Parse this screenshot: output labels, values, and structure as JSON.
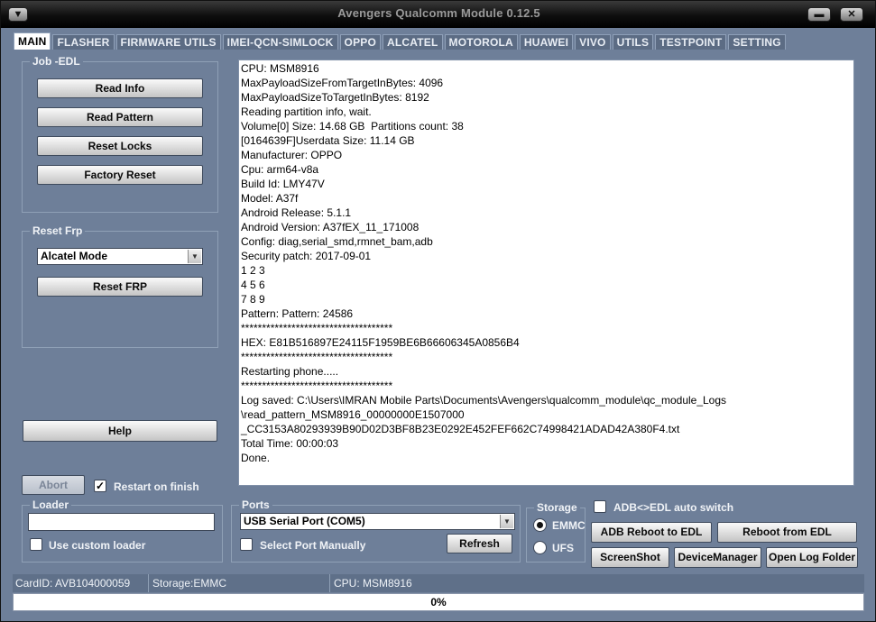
{
  "window": {
    "title": "Avengers Qualcomm Module 0.12.5"
  },
  "tabs": [
    "MAIN",
    "FLASHER",
    "FIRMWARE UTILS",
    "IMEI-QCN-SIMLOCK",
    "OPPO",
    "ALCATEL",
    "MOTOROLA",
    "HUAWEI",
    "VIVO",
    "UTILS",
    "TESTPOINT",
    "SETTING"
  ],
  "active_tab": "MAIN",
  "job_edl": {
    "title": "Job -EDL",
    "read_info": "Read Info",
    "read_pattern": "Read Pattern",
    "reset_locks": "Reset Locks",
    "factory_reset": "Factory Reset"
  },
  "reset_frp": {
    "title": "Reset Frp",
    "mode_value": "Alcatel Mode",
    "reset_button": "Reset FRP"
  },
  "help_button": "Help",
  "abort_button": "Abort",
  "restart_on_finish": {
    "label": "Restart on finish",
    "checked": true
  },
  "loader": {
    "title": "Loader",
    "path_value": "",
    "use_custom_label": "Use custom loader",
    "use_custom_checked": false
  },
  "ports": {
    "title": "Ports",
    "selected_port": "USB Serial Port (COM5)",
    "select_manually_label": "Select Port Manually",
    "select_manually_checked": false,
    "refresh_button": "Refresh"
  },
  "storage": {
    "title": "Storage",
    "emmc_label": "EMMC",
    "ufs_label": "UFS",
    "selected": "EMMC"
  },
  "actions": {
    "adb_edl_auto_switch_label": "ADB<>EDL auto switch",
    "adb_edl_auto_switch_checked": false,
    "adb_reboot_to_edl": "ADB Reboot to EDL",
    "reboot_from_edl": "Reboot from EDL",
    "screenshot": "ScreenShot",
    "device_manager": "DeviceManager",
    "open_log_folder": "Open Log Folder"
  },
  "log_lines": [
    "CPU: MSM8916",
    "MaxPayloadSizeFromTargetInBytes: 4096",
    "MaxPayloadSizeToTargetInBytes: 8192",
    "Reading partition info, wait.",
    "Volume[0] Size: 14.68 GB  Partitions count: 38",
    "[0164639F]Userdata Size: 11.14 GB",
    "Manufacturer: OPPO",
    "Cpu: arm64-v8a",
    "Build Id: LMY47V",
    "Model: A37f",
    "Android Release: 5.1.1",
    "Android Version: A37fEX_11_171008",
    "Config: diag,serial_smd,rmnet_bam,adb",
    "Security patch: 2017-09-01",
    "1 2 3",
    "4 5 6",
    "7 8 9",
    "Pattern: Pattern: 24586",
    "************************************",
    "HEX: E81B516897E24115F1959BE6B66606345A0856B4",
    "************************************",
    "Restarting phone.....",
    "************************************",
    "Log saved: C:\\Users\\IMRAN Mobile Parts\\Documents\\Avengers\\qualcomm_module\\qc_module_Logs",
    "\\read_pattern_MSM8916_00000000E1507000",
    "_CC3153A80293939B90D02D3BF8B23E0292E452FEF662C74998421ADAD42A380F4.txt",
    "Total Time: 00:00:03",
    "Done."
  ],
  "status": {
    "card_id": "CardID: AVB104000059",
    "storage": "Storage:EMMC",
    "cpu": "CPU: MSM8916"
  },
  "progress": {
    "value": 0,
    "label": "0%"
  },
  "colors": {
    "panel": "#6e7f99",
    "titlebar": "#000000",
    "log_bg": "#ffffff"
  }
}
